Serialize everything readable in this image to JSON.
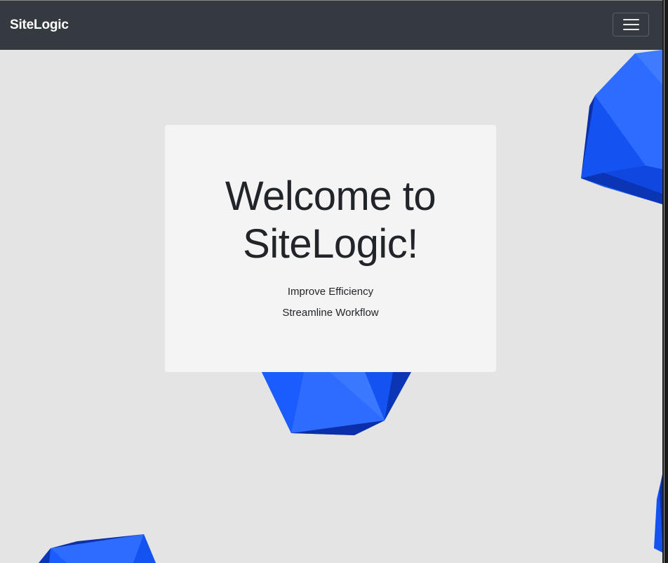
{
  "navbar": {
    "brand": "SiteLogic",
    "menu_icon": "hamburger-menu-icon"
  },
  "hero": {
    "title": "Welcome to SiteLogic!",
    "taglines": [
      "Improve Efficiency",
      "Streamline Workflow"
    ]
  },
  "colors": {
    "navbar_bg": "#343a40",
    "page_bg": "#e4e4e4",
    "card_bg": "#f4f4f4",
    "shape_blue": "#1a5cff",
    "shape_dark_blue": "#0a2fa8"
  }
}
